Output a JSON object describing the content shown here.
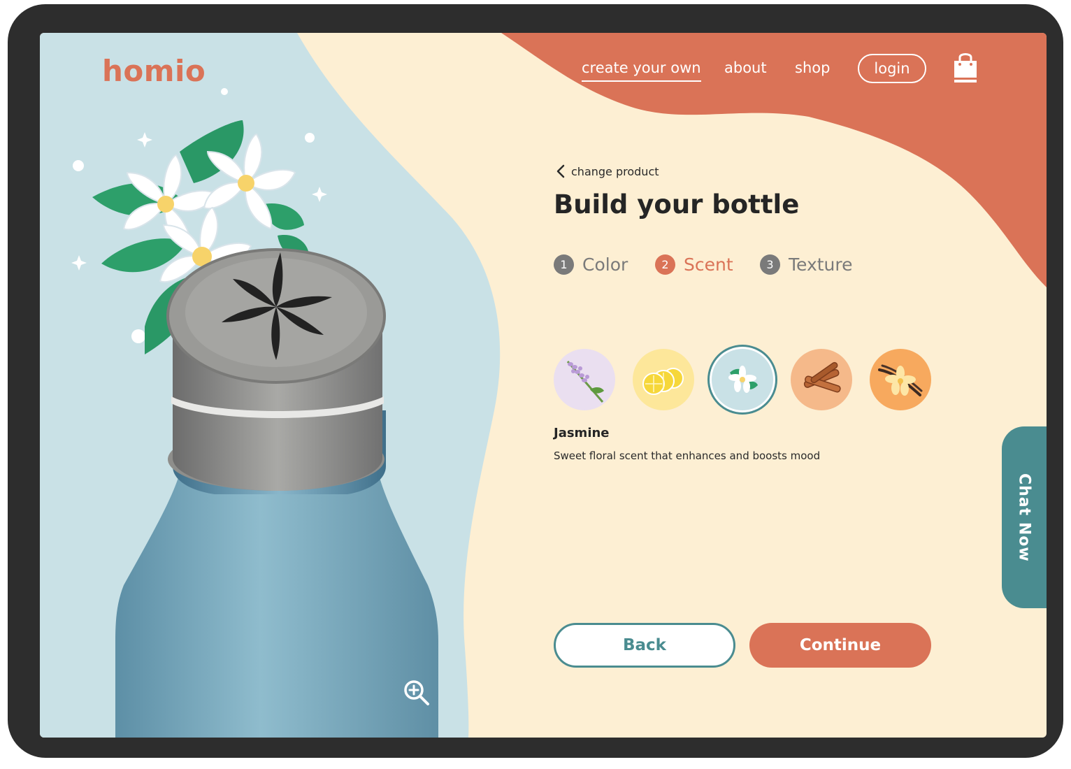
{
  "brand": {
    "logo": "homio"
  },
  "nav": {
    "items": [
      {
        "label": "create your own",
        "active": true
      },
      {
        "label": "about",
        "active": false
      },
      {
        "label": "shop",
        "active": false
      }
    ],
    "login_label": "login",
    "cart_icon": "shopping-bag-icon"
  },
  "builder": {
    "back_link": "change product",
    "title": "Build your bottle",
    "steps": [
      {
        "number": "1",
        "label": "Color",
        "active": false
      },
      {
        "number": "2",
        "label": "Scent",
        "active": true
      },
      {
        "number": "3",
        "label": "Texture",
        "active": false
      }
    ],
    "scents": [
      {
        "icon": "lavender-icon",
        "selected": false
      },
      {
        "icon": "lemon-icon",
        "selected": false
      },
      {
        "icon": "jasmine-icon",
        "selected": true
      },
      {
        "icon": "cinnamon-icon",
        "selected": false
      },
      {
        "icon": "vanilla-icon",
        "selected": false
      }
    ],
    "selected_scent": {
      "name": "Jasmine",
      "description": "Sweet floral scent that enhances and boosts mood"
    },
    "back_button": "Back",
    "continue_button": "Continue"
  },
  "chat": {
    "label": "Chat Now"
  },
  "preview": {
    "zoom_icon": "zoom-in-icon"
  },
  "colors": {
    "accent": "#da7357",
    "teal": "#4a8c90",
    "cream": "#fdefd3",
    "sky": "#c9e1e6",
    "bottle": "#79aabf"
  }
}
